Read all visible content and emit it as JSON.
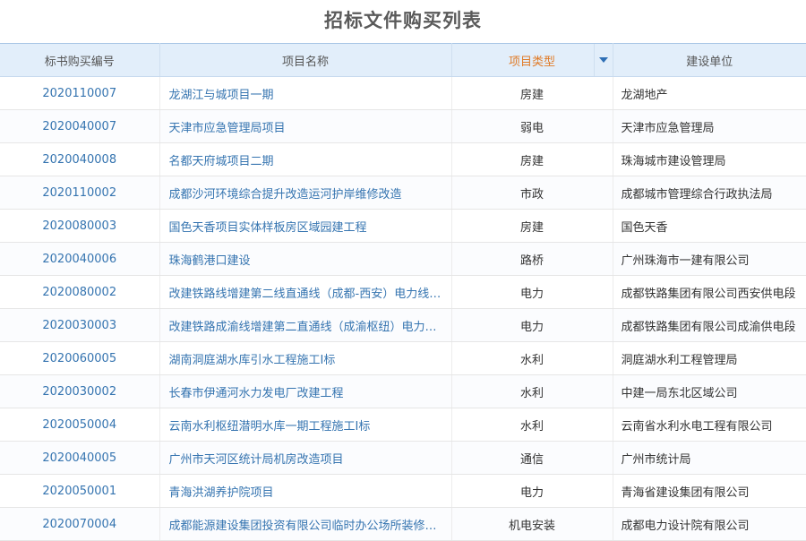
{
  "page": {
    "title": "招标文件购买列表"
  },
  "table": {
    "headers": [
      "标书购买编号",
      "项目名称",
      "项目类型",
      "建设单位"
    ],
    "rows": [
      {
        "code": "2020110007",
        "name": "龙湖江与城项目一期",
        "type": "房建",
        "unit": "龙湖地产"
      },
      {
        "code": "2020040007",
        "name": "天津市应急管理局项目",
        "type": "弱电",
        "unit": "天津市应急管理局"
      },
      {
        "code": "2020040008",
        "name": "名都天府城项目二期",
        "type": "房建",
        "unit": "珠海城市建设管理局"
      },
      {
        "code": "2020110002",
        "name": "成都沙河环境综合提升改造运河护岸维修改造",
        "type": "市政",
        "unit": "成都城市管理综合行政执法局"
      },
      {
        "code": "2020080003",
        "name": "国色天香项目实体样板房区域园建工程",
        "type": "房建",
        "unit": "国色天香"
      },
      {
        "code": "2020040006",
        "name": "珠海鹤港口建设",
        "type": "路桥",
        "unit": "广州珠海市一建有限公司"
      },
      {
        "code": "2020080002",
        "name": "改建铁路线增建第二线直通线（成都-西安）电力线…",
        "type": "电力",
        "unit": "成都铁路集团有限公司西安供电段"
      },
      {
        "code": "2020030003",
        "name": "改建铁路成渝线增建第二直通线（成渝枢纽）电力…",
        "type": "电力",
        "unit": "成都铁路集团有限公司成渝供电段"
      },
      {
        "code": "2020060005",
        "name": "湖南洞庭湖水库引水工程施工I标",
        "type": "水利",
        "unit": "洞庭湖水利工程管理局"
      },
      {
        "code": "2020030002",
        "name": "长春市伊通河水力发电厂改建工程",
        "type": "水利",
        "unit": "中建一局东北区域公司"
      },
      {
        "code": "2020050004",
        "name": "云南水利枢纽潜明水库一期工程施工I标",
        "type": "水利",
        "unit": "云南省水利水电工程有限公司"
      },
      {
        "code": "2020040005",
        "name": "广州市天河区统计局机房改造项目",
        "type": "通信",
        "unit": "广州市统计局"
      },
      {
        "code": "2020050001",
        "name": "青海洪湖养护院项目",
        "type": "电力",
        "unit": "青海省建设集团有限公司"
      },
      {
        "code": "2020070004",
        "name": "成都能源建设集团投资有限公司临时办公场所装修…",
        "type": "机电安装",
        "unit": "成都电力设计院有限公司"
      }
    ]
  },
  "colors": {
    "link": "#3574b0",
    "header_bg": "#e2eefa",
    "sort_accent": "#e07b28",
    "sort_arrow": "#2e6fb5"
  },
  "icons": {
    "sort": "caret-down-icon"
  }
}
